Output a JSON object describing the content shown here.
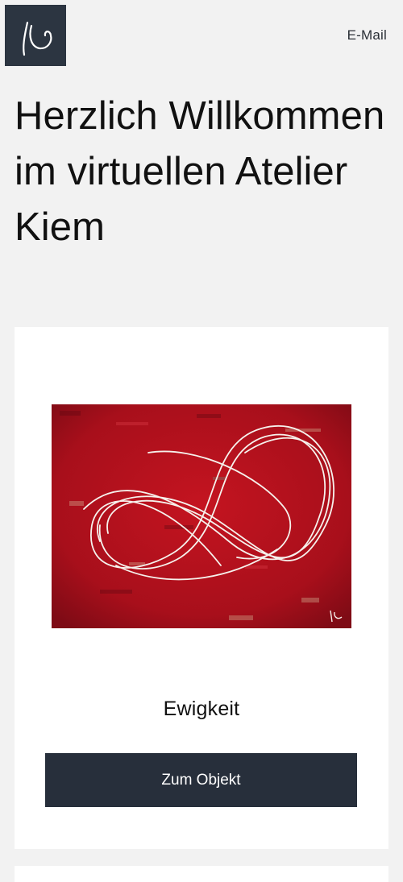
{
  "header": {
    "logo_icon": "signature-k-logo",
    "email_label": "E-Mail"
  },
  "hero": {
    "title": "Herzlich Willkommen im virtuellen Atelier Kiem"
  },
  "featured_artwork": {
    "image_icon": "red-abstract-painting-with-white-loops",
    "title": "Ewigkeit",
    "button_label": "Zum Objekt"
  },
  "colors": {
    "page_background": "#f2f2f2",
    "logo_background": "#2c3541",
    "button_background": "#272f3b",
    "card_background": "#ffffff",
    "painting_red": "#b5121e"
  }
}
